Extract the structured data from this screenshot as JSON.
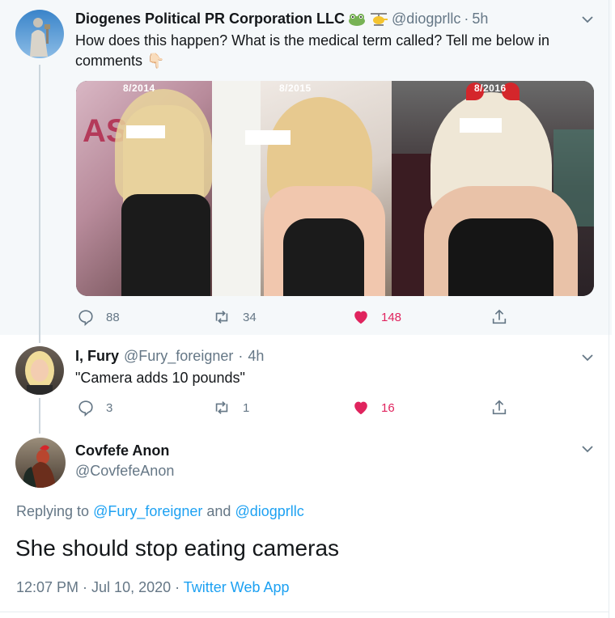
{
  "tweet1": {
    "display_name": "Diogenes Political PR Corporation LLC",
    "handle": "@diogprllc",
    "time": "5h",
    "text": "How does this happen? What is the medical term called? Tell me below in comments",
    "emoji": "👇🏻",
    "media": {
      "labels": [
        "8/2014",
        "8/2015",
        "8/2016"
      ]
    },
    "actions": {
      "replies": "88",
      "retweets": "34",
      "likes": "148"
    }
  },
  "tweet2": {
    "display_name": "I, Fury",
    "handle": "@Fury_foreigner",
    "time": "4h",
    "text": "\"Camera adds 10 pounds\"",
    "actions": {
      "replies": "3",
      "retweets": "1",
      "likes": "16"
    }
  },
  "tweet3": {
    "display_name": "Covfefe Anon",
    "handle": "@CovfefeAnon",
    "replying_prefix": "Replying to ",
    "reply_to_1": "@Fury_foreigner",
    "reply_and": " and ",
    "reply_to_2": "@diogprllc",
    "text": "She should stop eating cameras",
    "timestamp": "12:07 PM · Jul 10, 2020",
    "separator": " · ",
    "client": "Twitter Web App"
  },
  "colors": {
    "accent": "#1da1f2",
    "like": "#e0245e",
    "muted": "#657786"
  },
  "icons": [
    "frog-emoji-icon",
    "helicopter-emoji-icon",
    "reply-icon",
    "retweet-icon",
    "heart-icon",
    "share-icon",
    "chevron-down-icon"
  ]
}
